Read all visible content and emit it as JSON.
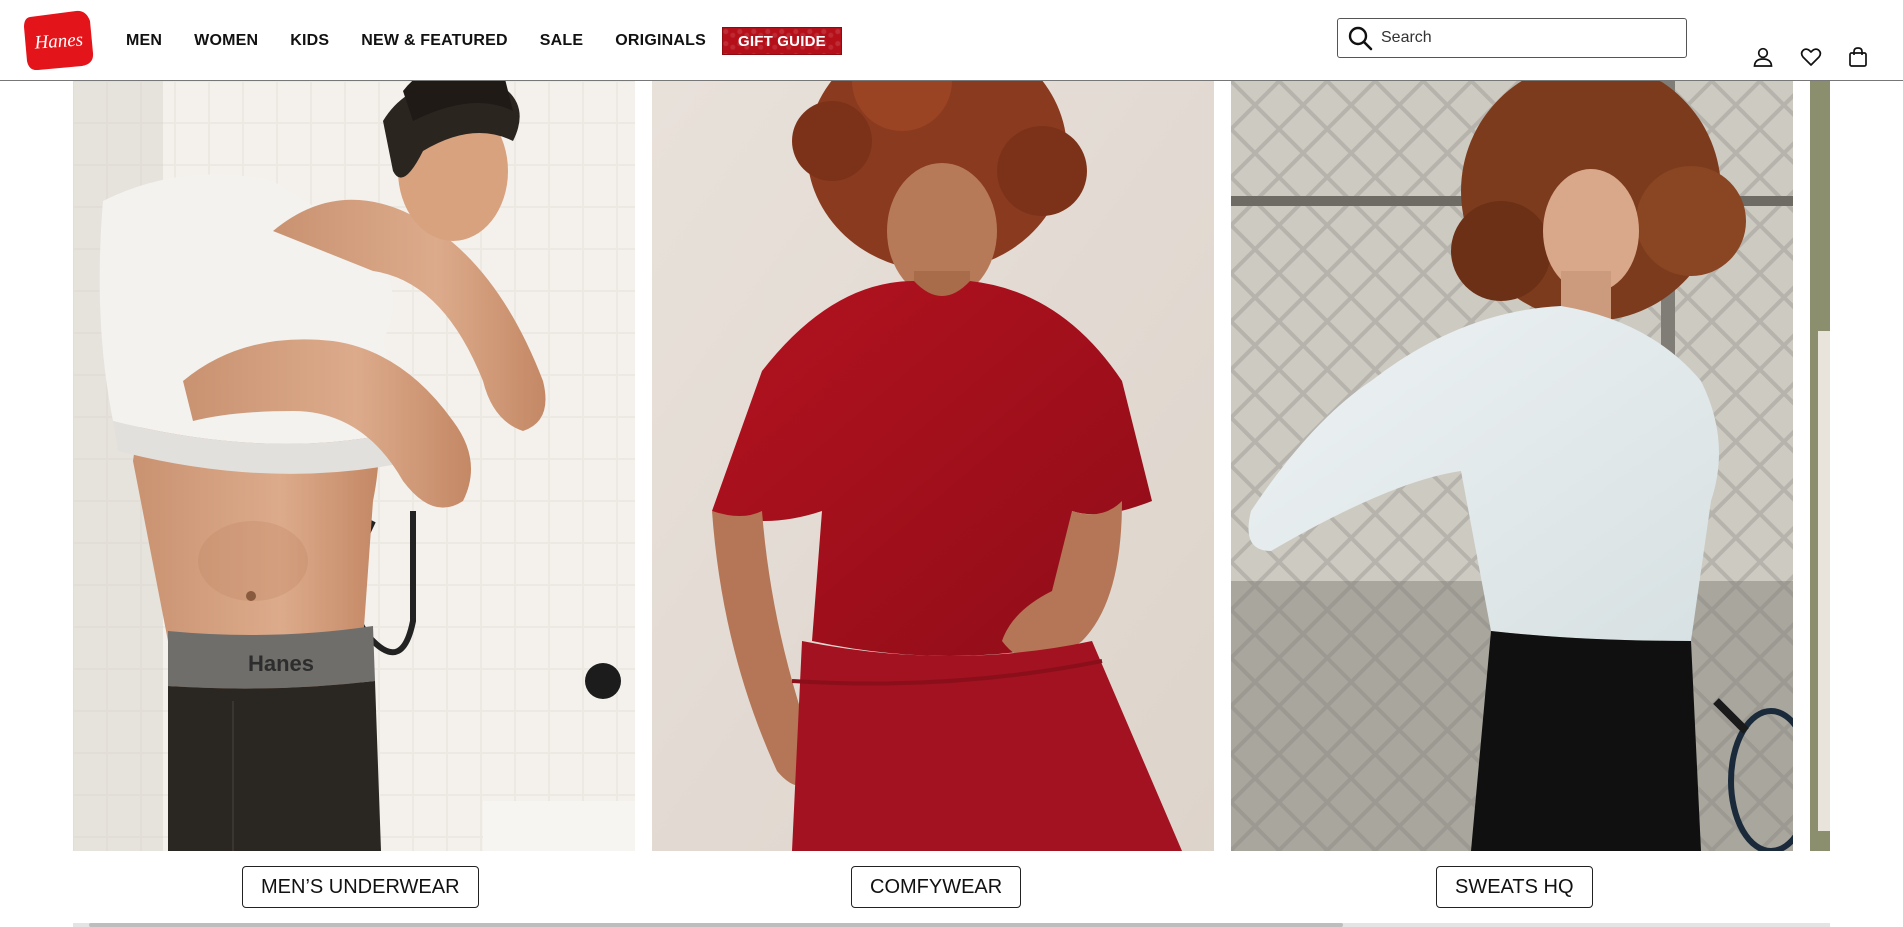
{
  "brand": {
    "logo_text": "Hanes",
    "logo_color": "#e3151b"
  },
  "nav": {
    "items": [
      {
        "label": "MEN"
      },
      {
        "label": "WOMEN"
      },
      {
        "label": "KIDS"
      },
      {
        "label": "NEW & FEATURED"
      },
      {
        "label": "SALE"
      },
      {
        "label": "ORIGINALS"
      }
    ],
    "gift_guide": {
      "label": "GIFT GUIDE",
      "color": "#b5101a"
    }
  },
  "search": {
    "placeholder": "Search",
    "value": ""
  },
  "header_icons": [
    "account-icon",
    "wishlist-heart-icon",
    "shopping-bag-icon"
  ],
  "categories": [
    {
      "label": "MEN’S UNDERWEAR",
      "image": "man-pulling-white-tshirt-photo"
    },
    {
      "label": "COMFYWEAR",
      "image": "woman-red-tee-shorts-photo"
    },
    {
      "label": "SWEATS HQ",
      "image": "woman-white-sweatshirt-tennis-photo"
    }
  ],
  "carousel": {
    "scroll_progress": 0.72
  }
}
